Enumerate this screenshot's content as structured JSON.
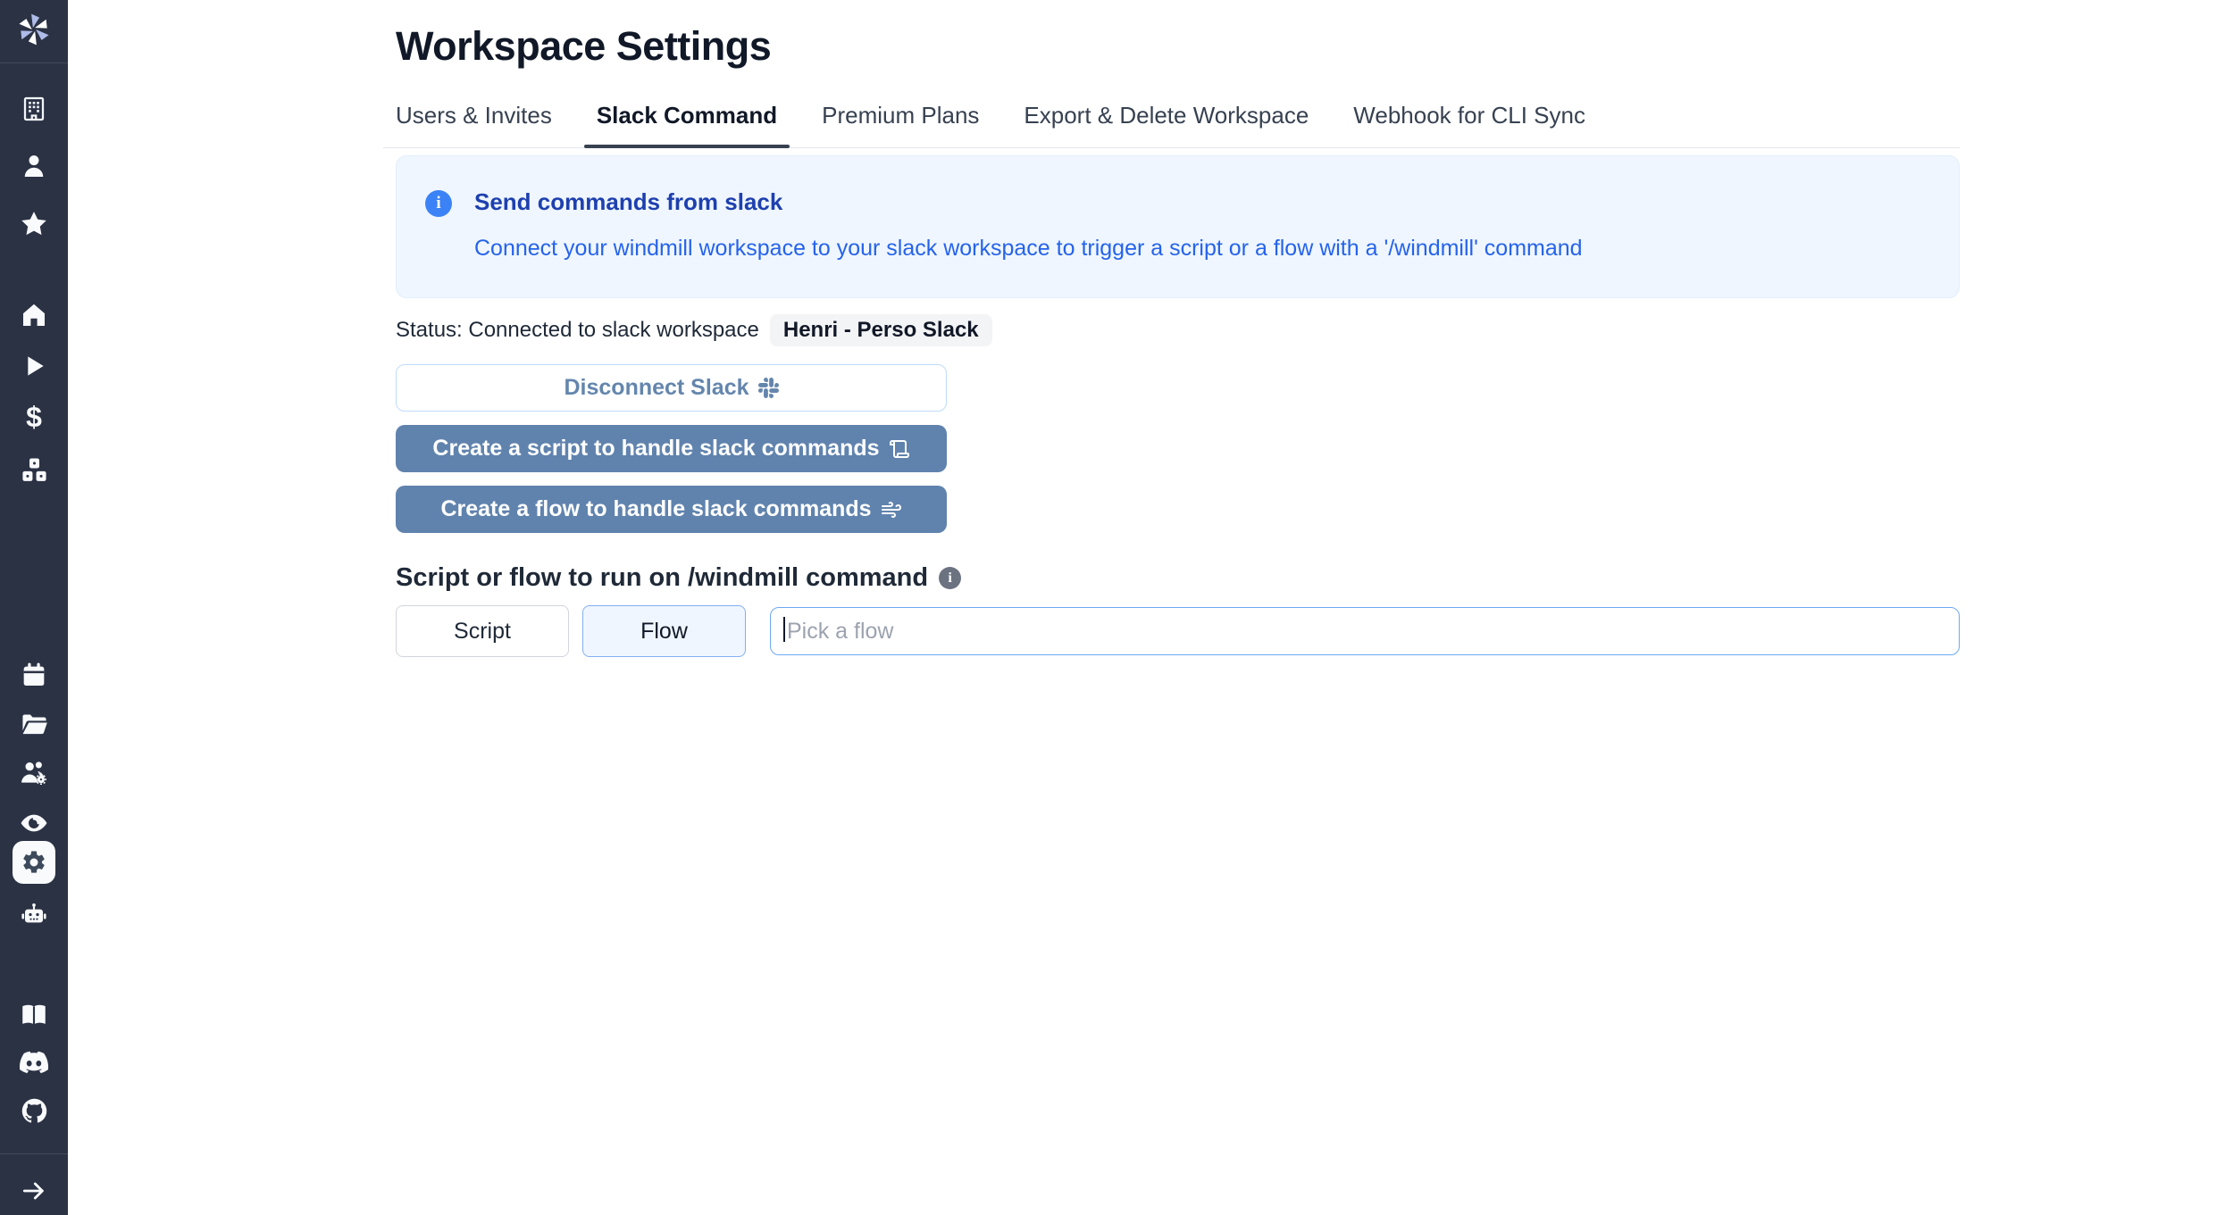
{
  "app": {
    "name": "Windmill",
    "context": "Workspace settings page"
  },
  "colors": {
    "sidebar_bg": "#2b3244",
    "accent_steel_blue": "#6083ae",
    "info_banner_bg": "#eff6ff",
    "info_icon_blue": "#3b82f6",
    "info_title_blue": "#1e40af",
    "link_blue": "#2563eb",
    "active_tab_underline": "#374151",
    "input_border_blue": "#6ea8f5",
    "badge_bg": "#f3f4f6"
  },
  "sidebar": {
    "logo_icon": "windmill-logo",
    "top_icons": [
      "building-icon",
      "user-icon",
      "star-icon"
    ],
    "nav_icons": [
      "home-icon",
      "play-icon",
      "dollar-icon",
      "boxes-icon"
    ],
    "workspace_icons": [
      "calendar-icon",
      "folder-open-icon",
      "users-gear-icon",
      "eye-icon",
      "gear-icon",
      "robot-icon"
    ],
    "active_item": "settings",
    "link_icons": [
      "book-open-icon",
      "discord-icon",
      "github-icon"
    ],
    "expand_icon": "arrow-right-icon",
    "dollar_glyph": "$"
  },
  "header": {
    "title": "Workspace Settings"
  },
  "tabs": [
    {
      "label": "Users & Invites",
      "active": false
    },
    {
      "label": "Slack Command",
      "active": true
    },
    {
      "label": "Premium Plans",
      "active": false
    },
    {
      "label": "Export & Delete Workspace",
      "active": false
    },
    {
      "label": "Webhook for CLI Sync",
      "active": false
    }
  ],
  "info_banner": {
    "icon": "info-icon",
    "title": "Send commands from slack",
    "link": "Connect your windmill workspace to your slack workspace to trigger a script or a flow with a '/windmill' command"
  },
  "status": {
    "label": "Status: Connected to slack workspace",
    "workspace_badge": "Henri - Perso Slack"
  },
  "actions": {
    "disconnect_label": "Disconnect Slack",
    "disconnect_icon": "slack-icon",
    "create_script_label": "Create a script to handle slack commands",
    "create_script_icon": "scroll-icon",
    "create_flow_label": "Create a flow to handle slack commands",
    "create_flow_icon": "wind-icon"
  },
  "command_section": {
    "heading": "Script or flow to run on /windmill command",
    "heading_icon": "info-icon",
    "script_toggle_label": "Script",
    "flow_toggle_label": "Flow",
    "selected_mode": "Flow",
    "flow_picker_placeholder": "Pick a flow",
    "flow_picker_value": ""
  }
}
